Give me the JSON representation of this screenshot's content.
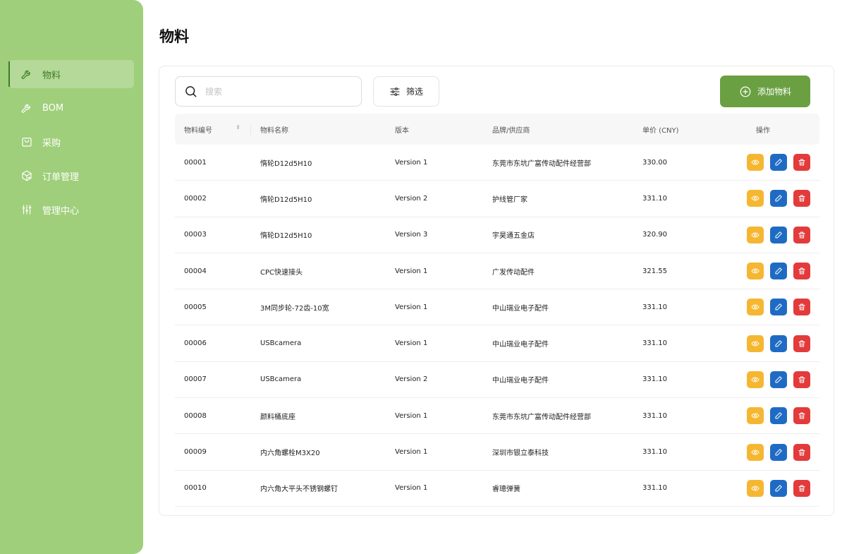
{
  "sidebar": {
    "items": [
      {
        "label": "物料",
        "icon": "wrench-icon",
        "active": true
      },
      {
        "label": "BOM",
        "icon": "wrench-icon",
        "active": false
      },
      {
        "label": "采购",
        "icon": "shopping-bag-icon",
        "active": false
      },
      {
        "label": "订单管理",
        "icon": "package-icon",
        "active": false
      },
      {
        "label": "管理中心",
        "icon": "sliders-icon",
        "active": false
      }
    ]
  },
  "page": {
    "title": "物料"
  },
  "toolbar": {
    "search_placeholder": "搜索",
    "search_value": "",
    "filter_label": "筛选",
    "add_label": "添加物料"
  },
  "table": {
    "headers": [
      "物料编号",
      "物料名称",
      "版本",
      "品牌/供应商",
      "单价 (CNY)",
      "操作"
    ],
    "rows": [
      {
        "id": "00001",
        "name": "惰轮D12d5H10",
        "version": "Version 1",
        "supplier": "东莞市东坑广富传动配件经营部",
        "price": "330.00"
      },
      {
        "id": "00002",
        "name": "惰轮D12d5H10",
        "version": "Version 2",
        "supplier": "护线管厂家",
        "price": "331.10"
      },
      {
        "id": "00003",
        "name": "惰轮D12d5H10",
        "version": "Version 3",
        "supplier": "宇昊通五金店",
        "price": "320.90"
      },
      {
        "id": "00004",
        "name": "CPC快速接头",
        "version": "Version 1",
        "supplier": "广发传动配件",
        "price": "321.55"
      },
      {
        "id": "00005",
        "name": "3M同步轮-72齿-10宽",
        "version": "Version 1",
        "supplier": "中山瑞业电子配件",
        "price": "331.10"
      },
      {
        "id": "00006",
        "name": "USBcamera",
        "version": "Version 1",
        "supplier": "中山瑞业电子配件",
        "price": "331.10"
      },
      {
        "id": "00007",
        "name": "USBcamera",
        "version": "Version 2",
        "supplier": "中山瑞业电子配件",
        "price": "331.10"
      },
      {
        "id": "00008",
        "name": "颜料桶底座",
        "version": "Version 1",
        "supplier": "东莞市东坑广富传动配件经营部",
        "price": "331.10"
      },
      {
        "id": "00009",
        "name": "内六角螺栓M3X20",
        "version": "Version 1",
        "supplier": "深圳市银立泰科技",
        "price": "331.10"
      },
      {
        "id": "00010",
        "name": "内六角大平头不锈钢螺钉",
        "version": "Version 1",
        "supplier": "睿璁弹簧",
        "price": "331.10"
      }
    ]
  },
  "colors": {
    "sidebar": "#9fcf7b",
    "accent": "#6aa042",
    "view": "#f5b731",
    "edit": "#1f6bc4",
    "delete": "#e33b3b"
  }
}
